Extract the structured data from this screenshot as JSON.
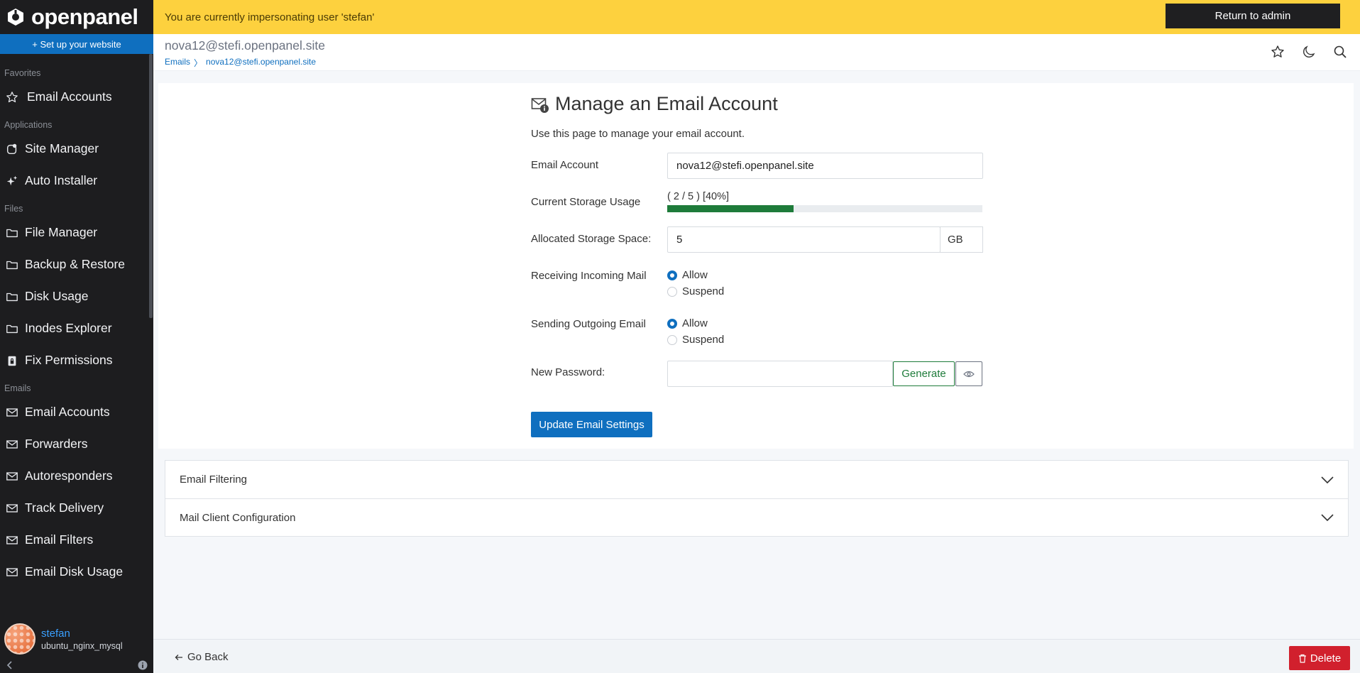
{
  "app": {
    "brand": "openpanel"
  },
  "sidebar": {
    "setup_label": "+ Set up your website",
    "sections": {
      "favorites": "Favorites",
      "applications": "Applications",
      "files": "Files",
      "emails": "Emails"
    },
    "favorites": [
      {
        "label": "Email Accounts",
        "icon": "star-icon"
      }
    ],
    "applications": [
      {
        "label": "Site Manager",
        "icon": "site-manager-icon"
      },
      {
        "label": "Auto Installer",
        "icon": "sparkle-icon"
      }
    ],
    "files": [
      {
        "label": "File Manager",
        "icon": "folder-icon"
      },
      {
        "label": "Backup & Restore",
        "icon": "folder-icon"
      },
      {
        "label": "Disk Usage",
        "icon": "folder-icon"
      },
      {
        "label": "Inodes Explorer",
        "icon": "folder-icon"
      },
      {
        "label": "Fix Permissions",
        "icon": "file-lock-icon"
      }
    ],
    "emails": [
      {
        "label": "Email Accounts",
        "icon": "envelope-icon"
      },
      {
        "label": "Forwarders",
        "icon": "envelope-icon"
      },
      {
        "label": "Autoresponders",
        "icon": "envelope-icon"
      },
      {
        "label": "Track Delivery",
        "icon": "envelope-icon"
      },
      {
        "label": "Email Filters",
        "icon": "envelope-icon"
      },
      {
        "label": "Email Disk Usage",
        "icon": "envelope-icon"
      }
    ],
    "user": {
      "name": "stefan",
      "sub": "ubuntu_nginx_mysql"
    }
  },
  "topbar": {
    "impersonation_text": "You are currently impersonating user 'stefan'",
    "return_label": "Return to admin"
  },
  "header": {
    "title": "nova12@stefi.openpanel.site",
    "breadcrumb": {
      "root": "Emails",
      "separator": "〉",
      "current": "nova12@stefi.openpanel.site"
    }
  },
  "form": {
    "title": "Manage an Email Account",
    "description": "Use this page to manage your email account.",
    "email_account": {
      "label": "Email Account",
      "value": "nova12@stefi.openpanel.site"
    },
    "storage_usage": {
      "label": "Current Storage Usage",
      "text": "( 2 / 5 ) [40%]",
      "percent": 40
    },
    "allocated": {
      "label": "Allocated Storage Space:",
      "value": "5",
      "unit": "GB"
    },
    "incoming": {
      "label": "Receiving Incoming Mail",
      "options": [
        "Allow",
        "Suspend"
      ],
      "selected": "Allow"
    },
    "outgoing": {
      "label": "Sending Outgoing Email",
      "options": [
        "Allow",
        "Suspend"
      ],
      "selected": "Allow"
    },
    "password": {
      "label": "New Password:",
      "value": "",
      "generate_label": "Generate"
    },
    "submit_label": "Update Email Settings"
  },
  "accordion": [
    {
      "label": "Email Filtering"
    },
    {
      "label": "Mail Client Configuration"
    }
  ],
  "footer": {
    "back_label": "Go Back",
    "delete_label": "Delete"
  },
  "colors": {
    "sidebar_bg": "#1d1d1f",
    "accent": "#0f6fbf",
    "banner": "#fdd13e",
    "progress": "#1e7b3a",
    "danger": "#d1202d"
  }
}
